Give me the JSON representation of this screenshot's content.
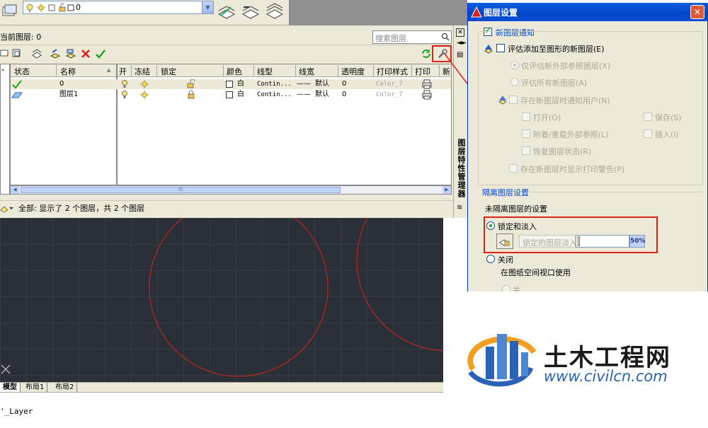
{
  "toolbar": {
    "layer_combo_value": "0"
  },
  "palette": {
    "current_layer": "当前图层: 0",
    "search_placeholder": "搜索图层",
    "side_title": "图层特性管理器",
    "headers": [
      "状态",
      "名称",
      "开",
      "冻结",
      "锁定",
      "颜色",
      "线型",
      "线宽",
      "透明度",
      "打印样式",
      "打印",
      "新"
    ],
    "rows": [
      {
        "name": "0",
        "color": "白",
        "linetype": "Contin...",
        "lineweight": "默认",
        "transparency": "0",
        "plot_style": "Color_7"
      },
      {
        "name": "图层1",
        "color": "白",
        "linetype": "Contin...",
        "lineweight": "默认",
        "transparency": "0",
        "plot_style": "Color_7"
      }
    ],
    "status": "全部: 显示了 2 个图层，共 2 个图层"
  },
  "tabs": [
    "模型",
    "布局1",
    "布局2"
  ],
  "command_line": "'_Layer",
  "dialog": {
    "title": "图层设置",
    "grp_new_layer_notify": "新图层通知",
    "eval_new_layers": "评估添加至图形的新图层(E)",
    "eval_xref_only": "仅评估新外部参照图层(X)",
    "eval_all": "评估所有新图层(A)",
    "notify_when_exists": "存在新图层时通知用户(N)",
    "open": "打开(O)",
    "save": "保存(S)",
    "attach_reload": "附着/重载外部参照(L)",
    "insert": "插入(I)",
    "restore_state": "恢复图层状态(R)",
    "plot_warning": "存在新图层时显示打印警告(P)",
    "isolate_section": "隔离图层设置",
    "unisolated_settings": "未隔离图层的设置",
    "lock_fade": "锁定和淡入",
    "lock_fade_label": "锁定的图层淡入",
    "fade_value": "50%",
    "off": "关闭",
    "in_paper_space": "在图纸空间视口使用",
    "off_sub": "关"
  },
  "watermark": {
    "name": "土木工程网",
    "url": "www.civilcn.com"
  },
  "colors": {
    "accent_red": "#d8221a",
    "titlebar": "#0a5fe0",
    "circle": "#d8221a"
  }
}
